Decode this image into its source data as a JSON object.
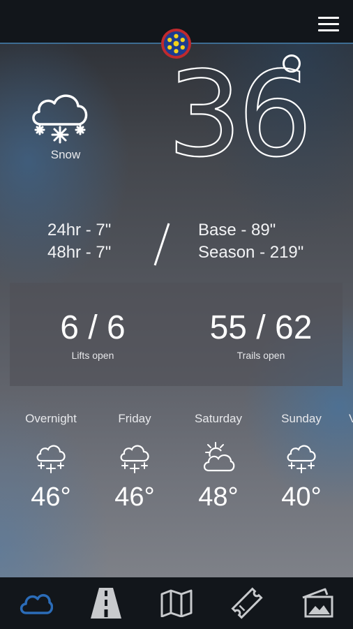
{
  "app": {
    "title": ""
  },
  "header": {
    "menu_icon": "hamburger-menu-icon",
    "logo_icon": "resort-snowflake-logo-icon"
  },
  "current": {
    "condition": "Snow",
    "icon": "snow-cloud-icon",
    "temperature": "36",
    "degree_symbol": "°"
  },
  "snowfall": {
    "h24": "24hr - 7\"",
    "h48": "48hr - 7\"",
    "base": "Base - 89\"",
    "season": "Season - 219\""
  },
  "status": {
    "lifts_value": "6 / 6",
    "lifts_label": "Lifts open",
    "trails_value": "55 / 62",
    "trails_label": "Trails open"
  },
  "forecast": [
    {
      "day": "Overnight",
      "temp": "46°",
      "icon": "snow-cloud-icon"
    },
    {
      "day": "Friday",
      "temp": "46°",
      "icon": "snow-cloud-icon"
    },
    {
      "day": "Saturday",
      "temp": "48°",
      "icon": "partly-sunny-icon"
    },
    {
      "day": "Sunday",
      "temp": "40°",
      "icon": "snow-cloud-icon"
    }
  ],
  "forecast_overflow": "V",
  "bottom_nav": [
    {
      "icon": "weather-cloud-icon",
      "active": true
    },
    {
      "icon": "road-icon",
      "active": false
    },
    {
      "icon": "map-icon",
      "active": false
    },
    {
      "icon": "ticket-icon",
      "active": false
    },
    {
      "icon": "photos-icon",
      "active": false
    }
  ],
  "colors": {
    "accent": "#2b6cb8",
    "topbar_border": "#3e6d93",
    "nav_inactive": "#c8cacd"
  }
}
